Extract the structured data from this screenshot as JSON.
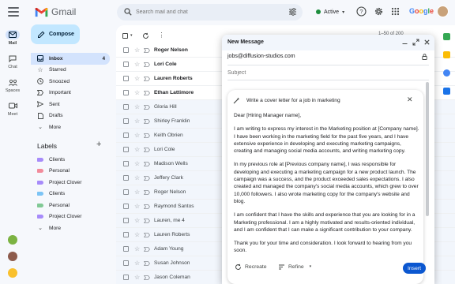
{
  "app": {
    "logo_text": "Gmail",
    "brand_text": "Google"
  },
  "search": {
    "placeholder": "Search mail and chat"
  },
  "status": {
    "label": "Active",
    "color": "#1e8e3e"
  },
  "rail": {
    "items": [
      {
        "label": "Mail",
        "icon": "mail-icon"
      },
      {
        "label": "Chat",
        "icon": "chat-icon"
      },
      {
        "label": "Spaces",
        "icon": "spaces-icon"
      },
      {
        "label": "Meet",
        "icon": "meet-icon"
      }
    ]
  },
  "compose_button": {
    "label": "Compose"
  },
  "nav": [
    {
      "label": "Inbox",
      "icon": "inbox-icon",
      "count": "4"
    },
    {
      "label": "Starred",
      "icon": "star-icon",
      "count": ""
    },
    {
      "label": "Snoozed",
      "icon": "clock-icon",
      "count": ""
    },
    {
      "label": "Important",
      "icon": "important-icon",
      "count": ""
    },
    {
      "label": "Sent",
      "icon": "send-icon",
      "count": ""
    },
    {
      "label": "Drafts",
      "icon": "draft-icon",
      "count": ""
    },
    {
      "label": "More",
      "icon": "chevron-down-icon",
      "count": ""
    }
  ],
  "labels": {
    "heading": "Labels",
    "items": [
      {
        "label": "Clients",
        "color": "#a78bfa"
      },
      {
        "label": "Personal",
        "color": "#f28b9b"
      },
      {
        "label": "Project Clover",
        "color": "#a78bfa"
      },
      {
        "label": "Clients",
        "color": "#7cc4f5"
      },
      {
        "label": "Personal",
        "color": "#81c995"
      },
      {
        "label": "Project Clover",
        "color": "#a78bfa"
      },
      {
        "label": "More",
        "color": ""
      }
    ]
  },
  "mail_list": {
    "pager": "1–50 of 200",
    "rows": [
      {
        "sender": "Roger Nelson",
        "unread": true
      },
      {
        "sender": "Lori Cole",
        "unread": true
      },
      {
        "sender": "Lauren Roberts",
        "unread": true
      },
      {
        "sender": "Ethan Lattimore",
        "unread": true
      },
      {
        "sender": "Gloria Hill",
        "unread": false
      },
      {
        "sender": "Shirley Franklin",
        "unread": false
      },
      {
        "sender": "Keith Obrien",
        "unread": false
      },
      {
        "sender": "Lori Cole",
        "unread": false
      },
      {
        "sender": "Madison Wells",
        "unread": false
      },
      {
        "sender": "Jeffery Clark",
        "unread": false
      },
      {
        "sender": "Roger Nelson",
        "unread": false
      },
      {
        "sender": "Raymond Santos",
        "unread": false
      },
      {
        "sender": "Lauren, me  4",
        "unread": false
      },
      {
        "sender": "Lauren Roberts",
        "unread": false
      },
      {
        "sender": "Adam Young",
        "unread": false
      },
      {
        "sender": "Susan Johnson",
        "unread": false
      },
      {
        "sender": "Jason Coleman",
        "unread": false
      }
    ]
  },
  "compose_window": {
    "title": "New Message",
    "to": "jobs@diffusion-studios.com",
    "subject_placeholder": "Subject"
  },
  "ai_card": {
    "prompt": "Write a cover letter for a job in marketing",
    "paragraphs": [
      "Dear [Hiring Manager name],",
      "I am writing to express my interest in the Marketing position at [Company name]. I have been working in the marketing field for the past five years, and I have extensive experience in developing and executing marketing campaigns, creating and managing social media accounts, and writing marketing copy.",
      "In my previous role at [Previous company name], I was responsible for developing and executing a marketing campaign for a new product launch. The campaign was a success, and the product exceeded sales expectations. I also created and managed the company's social media accounts, which grew to over 10,000 followers. I also wrote marketing copy for the company's website and blog.",
      "I am confident that I have the skills and experience that you are looking for in a Marketing professional. I am a highly motivated and results-oriented individual, and I am confident that I can make a significant contribution to your company.",
      "Thank you for your time and consideration. I look forward to hearing from you soon."
    ],
    "recreate_label": "Recreate",
    "refine_label": "Refine",
    "insert_label": "Insert"
  },
  "colors": {
    "accent": "#0b57d0",
    "compose_bg": "#c2e7ff",
    "active_nav": "#d3e3fd"
  }
}
